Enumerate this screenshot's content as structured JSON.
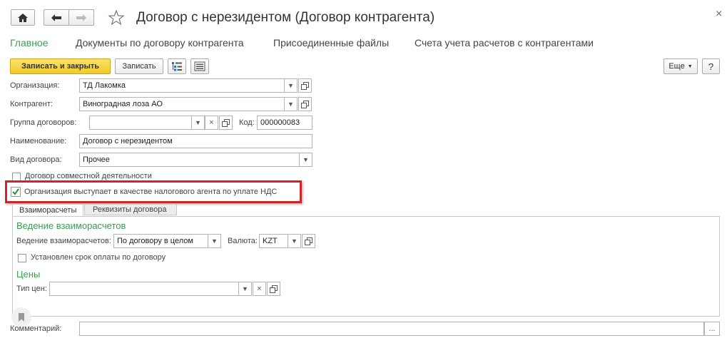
{
  "window": {
    "title": "Договор с нерезидентом (Договор контрагента)",
    "home_icon": "home-icon",
    "back_icon": "arrow-left-icon",
    "forward_icon": "arrow-right-icon",
    "star_icon": "star-icon",
    "close_icon": "close-icon",
    "close_glyph": "×"
  },
  "tabs": [
    {
      "label": "Главное",
      "active": true
    },
    {
      "label": "Документы по договору контрагента",
      "active": false
    },
    {
      "label": "Присоединенные файлы",
      "active": false
    },
    {
      "label": "Счета учета расчетов с контрагентами",
      "active": false
    }
  ],
  "toolbar": {
    "save_close_label": "Записать и закрыть",
    "save_label": "Записать",
    "more_label": "Еще",
    "help_label": "?",
    "tree_icon": "structure-icon",
    "list_icon": "list-icon"
  },
  "form": {
    "organization": {
      "label": "Организация:",
      "value": "ТД Лакомка"
    },
    "counterparty": {
      "label": "Контрагент:",
      "value": "Виноградная лоза АО"
    },
    "group": {
      "label": "Группа договоров:",
      "value": ""
    },
    "code": {
      "label": "Код:",
      "value": "000000083"
    },
    "name": {
      "label": "Наименование:",
      "value": "Договор с нерезидентом"
    },
    "contract_type": {
      "label": "Вид договора:",
      "value": "Прочее"
    },
    "joint_activity": {
      "label": "Договор совместной деятельности",
      "checked": false
    },
    "tax_agent": {
      "label": "Организация выступает в качестве налогового агента по уплате НДС",
      "checked": true
    },
    "comment": {
      "label": "Комментарий:",
      "value": ""
    },
    "comment_btn": "..."
  },
  "inner_tabs": [
    {
      "label": "Взаиморасчеты",
      "active": true
    },
    {
      "label": "Реквизиты договора",
      "active": false
    }
  ],
  "settlements": {
    "section_title": "Ведение взаиморасчетов",
    "mode_label": "Ведение взаиморасчетов:",
    "mode_value": "По договору в целом",
    "currency_label": "Валюта:",
    "currency_value": "KZT",
    "payment_term": {
      "label": "Установлен срок оплаты по договору",
      "checked": false
    }
  },
  "prices": {
    "section_title": "Цены",
    "price_type_label": "Тип цен:",
    "price_type_value": ""
  },
  "colors": {
    "accent_green": "#3e9c52",
    "primary_button": "#f5d43a",
    "highlight_red": "#d0232a"
  }
}
